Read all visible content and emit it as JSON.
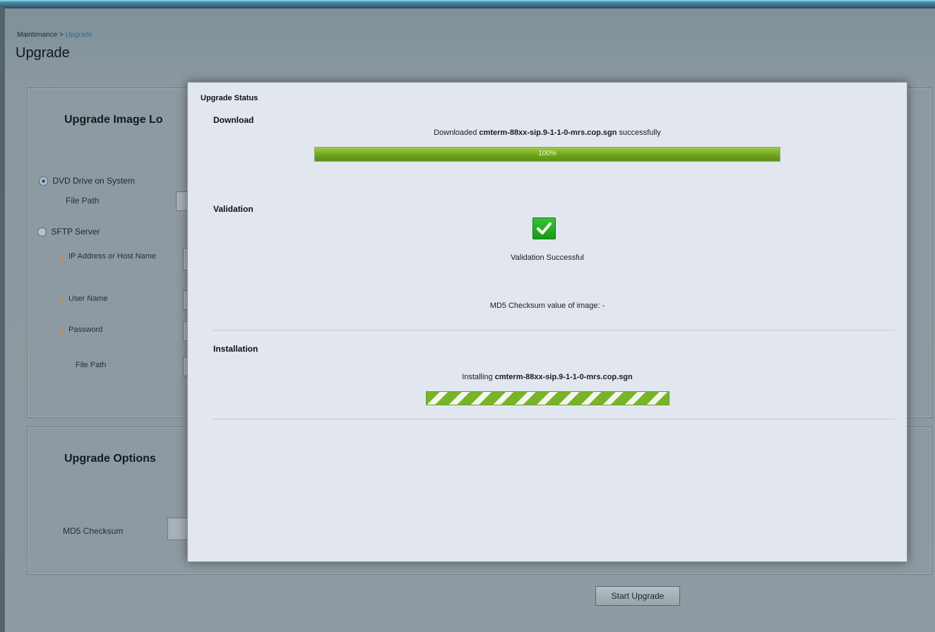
{
  "background": {
    "breadcrumb_parent": "Maintenance",
    "breadcrumb_separator": ">",
    "breadcrumb_current": "Upgrade",
    "page_title": "Upgrade",
    "location_panel": {
      "heading": "Upgrade Image Lo",
      "option_dvd": "DVD Drive on System",
      "file_path_label": "File Path",
      "option_sftp": "SFTP Server",
      "ip_label": "IP Address or Host Name",
      "username_label": "User Name",
      "password_label": "Password",
      "sftp_file_path_label": "File Path"
    },
    "options_panel": {
      "heading": "Upgrade Options",
      "md5_label": "MD5 Checksum"
    },
    "start_button_label": "Start Upgrade"
  },
  "modal": {
    "title": "Upgrade Status",
    "download": {
      "heading": "Download",
      "status_prefix": "Downloaded",
      "filename": "cmterm-88xx-sip.9-1-1-0-mrs.cop.sgn",
      "status_suffix": "successfully",
      "progress_label": "100%",
      "progress_fraction": 1.0,
      "progress_color": "#7ab22a"
    },
    "validation": {
      "heading": "Validation",
      "icon": "check-icon",
      "status": "Validation Successful",
      "md5_text": "MD5 Checksum value of image: -"
    },
    "installation": {
      "heading": "Installation",
      "status_prefix": "Installing",
      "filename": "cmterm-88xx-sip.9-1-1-0-mrs.cop.sgn",
      "progress_state": "indeterminate"
    }
  }
}
